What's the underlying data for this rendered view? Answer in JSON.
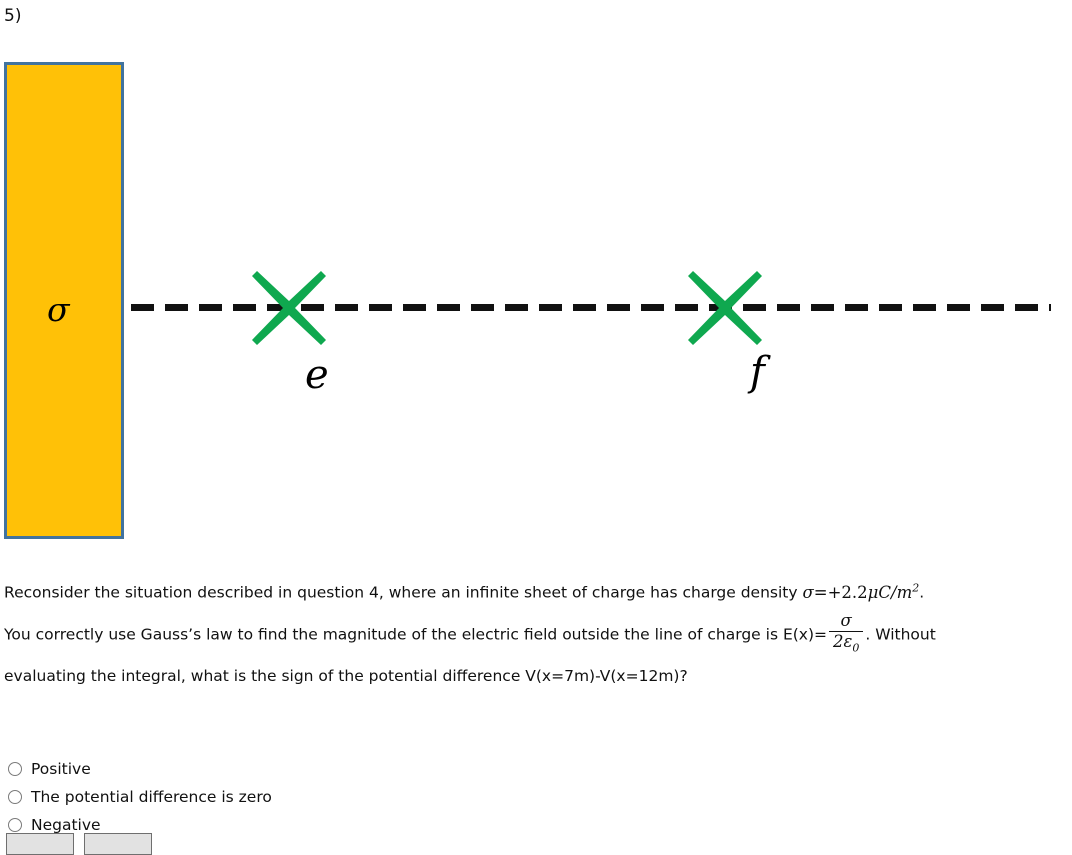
{
  "question": {
    "number_label": "5)"
  },
  "figure": {
    "sheet": {
      "name": "infinite-charged-sheet",
      "label": "σ",
      "fill_color": "#FFC107",
      "border_color": "#41739F"
    },
    "field_line": {
      "name": "dashed-axis-line",
      "color": "#111111",
      "style": "dashed"
    },
    "markers": [
      {
        "id": "e",
        "label": "e",
        "color": "#0FA84F"
      },
      {
        "id": "f",
        "label": "f",
        "color": "#0FA84F"
      }
    ]
  },
  "prose": {
    "line1_a": "Reconsider the situation described in question 4, where an infinite sheet of charge has charge density ",
    "line1_math_sigma": "σ",
    "line1_math_eq": "=+2.2",
    "line1_math_mu": "μ",
    "line1_math_C": "C",
    "line1_math_slash": "/",
    "line1_math_m": "m",
    "line1_math_exp": "2",
    "line1_end": ".",
    "line2_a": "You correctly use Gauss’s law to find the magnitude of the electric field outside the line of charge is E(x)=",
    "fraction_numerator": "σ",
    "fraction_denominator_coeff": "2",
    "fraction_denominator_eps": "ε",
    "fraction_denominator_sub": "0",
    "line2_b": ". Without",
    "line3": "evaluating the integral, what is the sign of the potential difference V(x=7m)-V(x=12m)?"
  },
  "choices": [
    {
      "id": "positive",
      "label": "Positive",
      "selected": false
    },
    {
      "id": "zero",
      "label": "The potential difference is zero",
      "selected": false
    },
    {
      "id": "negative",
      "label": "Negative",
      "selected": false
    }
  ],
  "buttons": [
    {
      "id": "button-left",
      "label": ""
    },
    {
      "id": "button-right",
      "label": ""
    }
  ]
}
